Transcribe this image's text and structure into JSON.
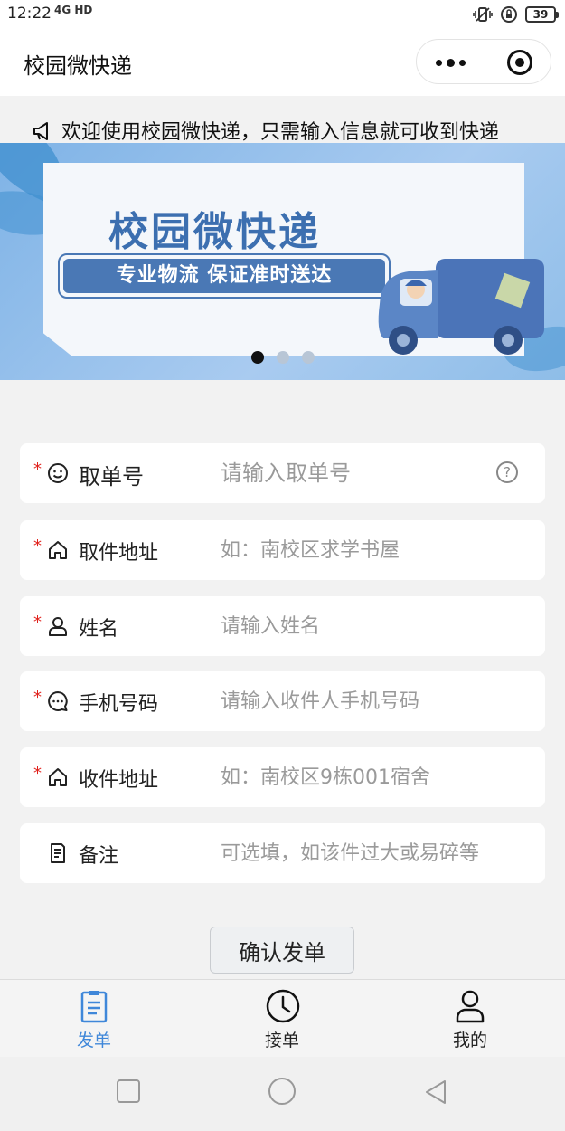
{
  "status_bar": {
    "time": "12:22",
    "signal": "4G HD",
    "battery": "39"
  },
  "header": {
    "title": "校园微快递",
    "more_icon": "more-dots-icon",
    "close_icon": "target-circle-icon"
  },
  "notice": {
    "icon": "megaphone-icon",
    "text": "欢迎使用校园微快递，只需输入信息就可收到快递"
  },
  "banner": {
    "title": "校园微快递",
    "subtitle": "专业物流 保证准时送达",
    "slides": 3,
    "active_slide": 1
  },
  "form": {
    "rows": [
      {
        "label": "取单号",
        "placeholder": "请输入取单号",
        "required": true,
        "icon": "smiley-icon"
      },
      {
        "label": "取件地址",
        "placeholder": "如：南校区求学书屋",
        "required": true,
        "icon": "home-icon"
      },
      {
        "label": "姓名",
        "placeholder": "请输入姓名",
        "required": true,
        "icon": "user-icon"
      },
      {
        "label": "手机号码",
        "placeholder": "请输入收件人手机号码",
        "required": true,
        "icon": "chat-bubble-icon"
      },
      {
        "label": "收件地址",
        "placeholder": "如：南校区9栋001宿舍",
        "required": true,
        "icon": "home-icon"
      },
      {
        "label": "备注",
        "placeholder": "可选填，如该件过大或易碎等",
        "required": false,
        "icon": "document-icon"
      }
    ],
    "required_mark": "*",
    "help_mark": "?",
    "submit_label": "确认发单"
  },
  "tabs": [
    {
      "label": "发单",
      "icon": "clipboard-icon",
      "active": true
    },
    {
      "label": "接单",
      "icon": "clock-icon",
      "active": false
    },
    {
      "label": "我的",
      "icon": "person-icon",
      "active": false
    }
  ],
  "colors": {
    "accent": "#3f87d9",
    "required": "#e0201b",
    "banner_blue": "#4a78b5"
  }
}
